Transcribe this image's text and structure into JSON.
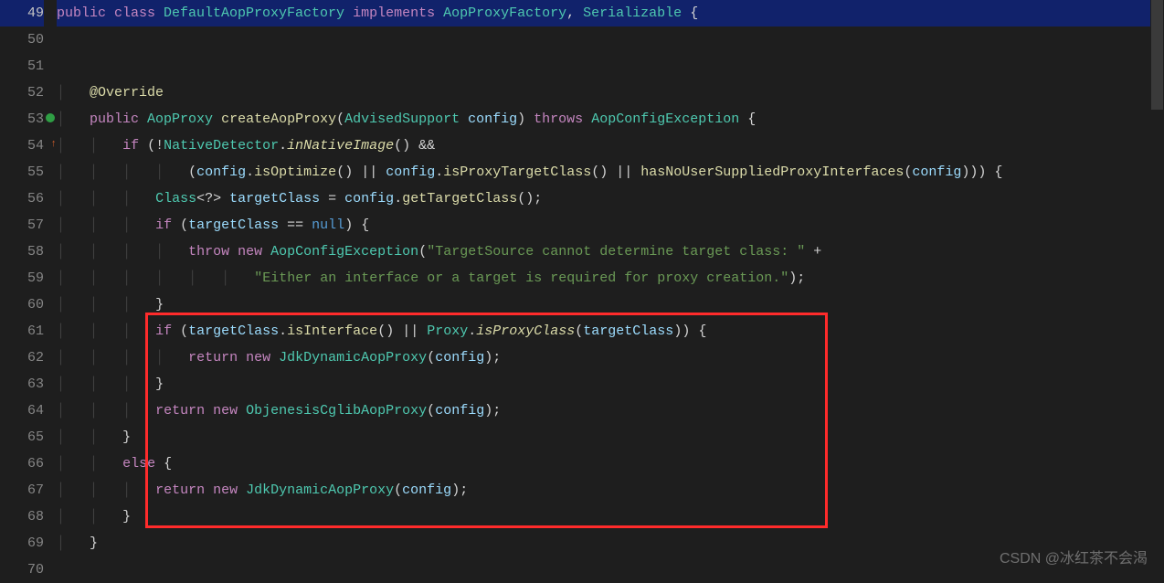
{
  "watermark": "CSDN @冰红茶不会渴",
  "gutter": {
    "start": 49,
    "end": 70,
    "current": 49,
    "marker_line": 53,
    "marker_icon": "override-gutter-icon"
  },
  "code": {
    "lines": [
      {
        "n": 49,
        "hl": true,
        "tokens": [
          {
            "t": "public ",
            "c": "kw"
          },
          {
            "t": "class ",
            "c": "kw"
          },
          {
            "t": "DefaultAopProxyFactory ",
            "c": "type"
          },
          {
            "t": "implements ",
            "c": "kw"
          },
          {
            "t": "AopProxyFactory",
            "c": "type"
          },
          {
            "t": ", ",
            "c": "op"
          },
          {
            "t": "Serializable ",
            "c": "type"
          },
          {
            "t": "{",
            "c": "op"
          }
        ]
      },
      {
        "n": 50,
        "tokens": []
      },
      {
        "n": 51,
        "tokens": []
      },
      {
        "n": 52,
        "indent": 1,
        "tokens": [
          {
            "t": "@Override",
            "c": "ann"
          }
        ]
      },
      {
        "n": 53,
        "indent": 1,
        "tokens": [
          {
            "t": "public ",
            "c": "kw"
          },
          {
            "t": "AopProxy ",
            "c": "type"
          },
          {
            "t": "createAopProxy",
            "c": "fn"
          },
          {
            "t": "(",
            "c": "op"
          },
          {
            "t": "AdvisedSupport ",
            "c": "type"
          },
          {
            "t": "config",
            "c": "id"
          },
          {
            "t": ") ",
            "c": "op"
          },
          {
            "t": "throws ",
            "c": "kw"
          },
          {
            "t": "AopConfigException ",
            "c": "type"
          },
          {
            "t": "{",
            "c": "op"
          }
        ]
      },
      {
        "n": 54,
        "indent": 2,
        "tokens": [
          {
            "t": "if ",
            "c": "kw"
          },
          {
            "t": "(!",
            "c": "op"
          },
          {
            "t": "NativeDetector",
            "c": "type"
          },
          {
            "t": ".",
            "c": "op"
          },
          {
            "t": "inNativeImage",
            "c": "fn it"
          },
          {
            "t": "() &&",
            "c": "op"
          }
        ]
      },
      {
        "n": 55,
        "indent": 4,
        "tokens": [
          {
            "t": "(",
            "c": "op"
          },
          {
            "t": "config",
            "c": "id"
          },
          {
            "t": ".",
            "c": "op"
          },
          {
            "t": "isOptimize",
            "c": "fn"
          },
          {
            "t": "() || ",
            "c": "op"
          },
          {
            "t": "config",
            "c": "id"
          },
          {
            "t": ".",
            "c": "op"
          },
          {
            "t": "isProxyTargetClass",
            "c": "fn"
          },
          {
            "t": "() || ",
            "c": "op"
          },
          {
            "t": "hasNoUserSuppliedProxyInterfaces",
            "c": "fn"
          },
          {
            "t": "(",
            "c": "op"
          },
          {
            "t": "config",
            "c": "id"
          },
          {
            "t": "))) {",
            "c": "op"
          }
        ]
      },
      {
        "n": 56,
        "indent": 3,
        "tokens": [
          {
            "t": "Class",
            "c": "type"
          },
          {
            "t": "<?> ",
            "c": "op"
          },
          {
            "t": "targetClass ",
            "c": "id"
          },
          {
            "t": "= ",
            "c": "op"
          },
          {
            "t": "config",
            "c": "id"
          },
          {
            "t": ".",
            "c": "op"
          },
          {
            "t": "getTargetClass",
            "c": "fn"
          },
          {
            "t": "();",
            "c": "op"
          }
        ]
      },
      {
        "n": 57,
        "indent": 3,
        "tokens": [
          {
            "t": "if ",
            "c": "kw"
          },
          {
            "t": "(",
            "c": "op"
          },
          {
            "t": "targetClass ",
            "c": "id"
          },
          {
            "t": "== ",
            "c": "op"
          },
          {
            "t": "null",
            "c": "kw2"
          },
          {
            "t": ") {",
            "c": "op"
          }
        ]
      },
      {
        "n": 58,
        "indent": 4,
        "tokens": [
          {
            "t": "throw ",
            "c": "kw"
          },
          {
            "t": "new ",
            "c": "kw"
          },
          {
            "t": "AopConfigException",
            "c": "type"
          },
          {
            "t": "(",
            "c": "op"
          },
          {
            "t": "\"TargetSource cannot determine target class: \"",
            "c": "str"
          },
          {
            "t": " +",
            "c": "op"
          }
        ]
      },
      {
        "n": 59,
        "indent": 6,
        "tokens": [
          {
            "t": "\"Either an interface or a target is required for proxy creation.\"",
            "c": "str"
          },
          {
            "t": ");",
            "c": "op"
          }
        ]
      },
      {
        "n": 60,
        "indent": 3,
        "tokens": [
          {
            "t": "}",
            "c": "op"
          }
        ]
      },
      {
        "n": 61,
        "indent": 3,
        "tokens": [
          {
            "t": "if ",
            "c": "kw"
          },
          {
            "t": "(",
            "c": "op"
          },
          {
            "t": "targetClass",
            "c": "id"
          },
          {
            "t": ".",
            "c": "op"
          },
          {
            "t": "isInterface",
            "c": "fn"
          },
          {
            "t": "() || ",
            "c": "op"
          },
          {
            "t": "Proxy",
            "c": "type"
          },
          {
            "t": ".",
            "c": "op"
          },
          {
            "t": "isProxyClass",
            "c": "fn it"
          },
          {
            "t": "(",
            "c": "op"
          },
          {
            "t": "targetClass",
            "c": "id"
          },
          {
            "t": ")) {",
            "c": "op"
          }
        ]
      },
      {
        "n": 62,
        "indent": 4,
        "tokens": [
          {
            "t": "return ",
            "c": "kw"
          },
          {
            "t": "new ",
            "c": "kw"
          },
          {
            "t": "JdkDynamicAopProxy",
            "c": "type"
          },
          {
            "t": "(",
            "c": "op"
          },
          {
            "t": "config",
            "c": "id"
          },
          {
            "t": ");",
            "c": "op"
          }
        ]
      },
      {
        "n": 63,
        "indent": 3,
        "tokens": [
          {
            "t": "}",
            "c": "op"
          }
        ]
      },
      {
        "n": 64,
        "indent": 3,
        "tokens": [
          {
            "t": "return ",
            "c": "kw"
          },
          {
            "t": "new ",
            "c": "kw"
          },
          {
            "t": "ObjenesisCglibAopProxy",
            "c": "type"
          },
          {
            "t": "(",
            "c": "op"
          },
          {
            "t": "config",
            "c": "id"
          },
          {
            "t": ");",
            "c": "op"
          }
        ]
      },
      {
        "n": 65,
        "indent": 2,
        "tokens": [
          {
            "t": "}",
            "c": "op"
          }
        ]
      },
      {
        "n": 66,
        "indent": 2,
        "tokens": [
          {
            "t": "else ",
            "c": "kw"
          },
          {
            "t": "{",
            "c": "op"
          }
        ]
      },
      {
        "n": 67,
        "indent": 3,
        "tokens": [
          {
            "t": "return ",
            "c": "kw"
          },
          {
            "t": "new ",
            "c": "kw"
          },
          {
            "t": "JdkDynamicAopProxy",
            "c": "type"
          },
          {
            "t": "(",
            "c": "op"
          },
          {
            "t": "config",
            "c": "id"
          },
          {
            "t": ");",
            "c": "op"
          }
        ]
      },
      {
        "n": 68,
        "indent": 2,
        "tokens": [
          {
            "t": "}",
            "c": "op"
          }
        ]
      },
      {
        "n": 69,
        "indent": 1,
        "tokens": [
          {
            "t": "}",
            "c": "op"
          }
        ]
      },
      {
        "n": 70,
        "tokens": []
      }
    ]
  }
}
